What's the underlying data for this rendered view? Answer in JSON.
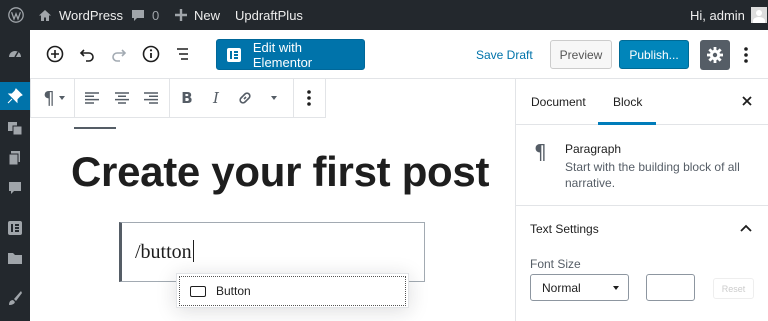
{
  "admin_bar": {
    "site_name": "WordPress",
    "comments_count": "0",
    "new_label": "New",
    "plugin_label": "UpdraftPlus",
    "greeting": "Hi, admin"
  },
  "header": {
    "elementor_label": "Edit with Elementor",
    "save_draft_label": "Save Draft",
    "preview_label": "Preview",
    "publish_label": "Publish..."
  },
  "content": {
    "title": "Create your first post",
    "paragraph_text": "/button",
    "autocomplete_item": "Button"
  },
  "sidebar": {
    "tabs": [
      {
        "label": "Document",
        "active": false
      },
      {
        "label": "Block",
        "active": true
      }
    ],
    "block_icon": "pilcrow-icon",
    "block_name": "Paragraph",
    "block_description": "Start with the building block of all narrative.",
    "panel_title": "Text Settings",
    "font_size_label": "Font Size",
    "font_size_value": "Normal",
    "reset_label": "Reset"
  },
  "colors": {
    "admin_bg": "#23282d",
    "accent": "#0073aa",
    "publish": "#0085ba",
    "tab_active": "#007cba"
  }
}
